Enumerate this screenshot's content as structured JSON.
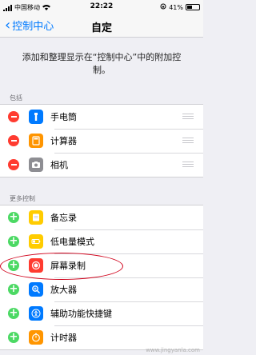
{
  "status": {
    "carrier": "中国移动",
    "time": "22:22",
    "battery": "41%",
    "battery_level": 0.41
  },
  "nav": {
    "back_label": "控制中心",
    "title": "自定"
  },
  "description": "添加和整理显示在“控制中心”中的附加控制。",
  "included": {
    "header": "包括",
    "items": [
      {
        "label": "手电筒",
        "icon": "flashlight-icon",
        "color": "#007aff"
      },
      {
        "label": "计算器",
        "icon": "calculator-icon",
        "color": "#ff9500"
      },
      {
        "label": "相机",
        "icon": "camera-icon",
        "color": "#8e8e93"
      }
    ]
  },
  "more": {
    "header": "更多控制",
    "items": [
      {
        "label": "备忘录",
        "icon": "notes-icon",
        "color": "#ffcc00"
      },
      {
        "label": "低电量模式",
        "icon": "battery-icon",
        "color": "#ffcc00"
      },
      {
        "label": "屏幕录制",
        "icon": "screen-record-icon",
        "color": "#ff3b30"
      },
      {
        "label": "放大器",
        "icon": "magnifier-icon",
        "color": "#007aff"
      },
      {
        "label": "辅助功能快捷键",
        "icon": "accessibility-icon",
        "color": "#007aff"
      },
      {
        "label": "计时器",
        "icon": "timer-icon",
        "color": "#ff9500"
      }
    ]
  },
  "watermark": "www.jingyanla.com"
}
